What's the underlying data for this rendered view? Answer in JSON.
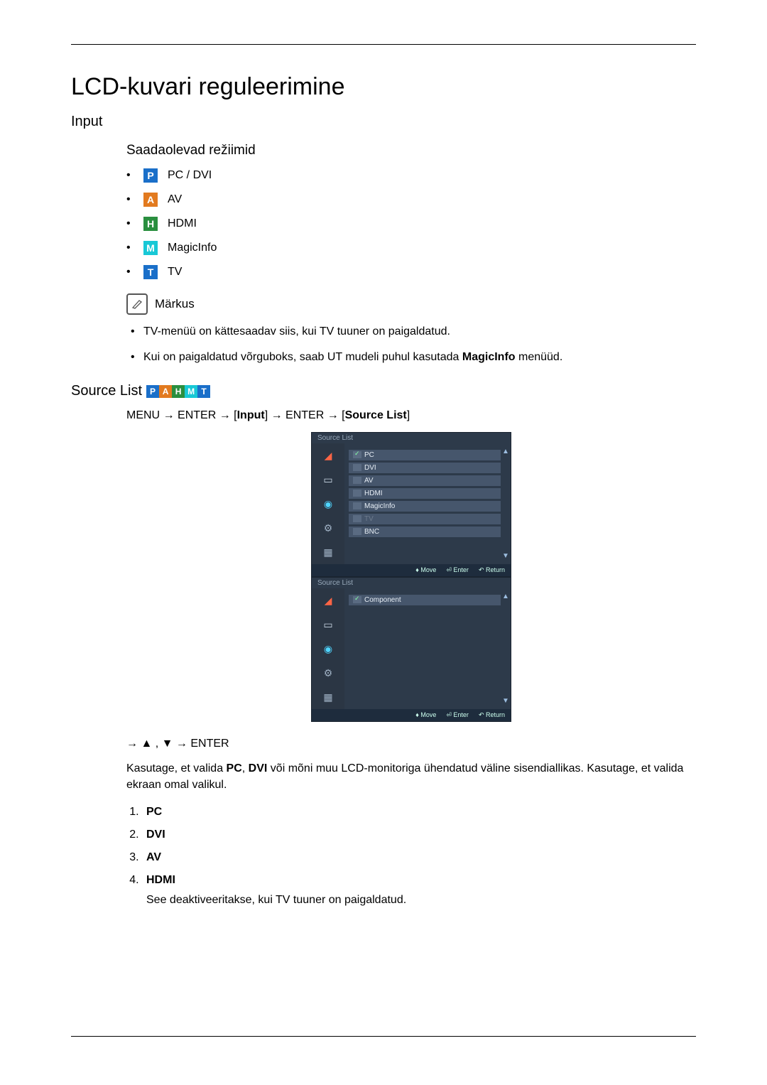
{
  "title": "LCD-kuvari reguleerimine",
  "input_section": "Input",
  "modes_heading": "Saadaolevad režiimid",
  "modes": {
    "pc_dvi": "PC / DVI",
    "av": "AV",
    "hdmi": "HDMI",
    "magicinfo": "MagicInfo",
    "tv": "TV"
  },
  "note_label": "Märkus",
  "notes": [
    "TV-menüü on kättesaadav siis, kui TV tuuner on paigaldatud.",
    "Kui on paigaldatud võrguboks, saab UT mudeli puhul kasutada MagicInfo menüüd."
  ],
  "source_list_label": "Source List",
  "menu_path": {
    "menu": "MENU",
    "arrow": "→",
    "enter": "ENTER",
    "input_br": "Input",
    "source_list_br": "Source List"
  },
  "osd": {
    "title": "Source List",
    "items1": [
      "PC",
      "DVI",
      "AV",
      "HDMI",
      "MagicInfo",
      "TV",
      "BNC"
    ],
    "items2": [
      "Component"
    ],
    "footer_move": "Move",
    "footer_enter": "Enter",
    "footer_return": "Return"
  },
  "after_nav": "→ ▲ , ▼ → ENTER",
  "desc_para": "Kasutage, et valida PC, DVI või mõni muu LCD-monitoriga ühendatud väline sisendiallikas. Kasutage, et valida ekraan omal valikul.",
  "desc_para_parts": {
    "p1a": "Kasutage, et valida ",
    "pc": "PC",
    "comma1": ", ",
    "dvi": "DVI",
    "p1b": " või mõni muu LCD-monitoriga ühendatud väline sisendiallikas. Kasutage, et valida ekraan omal valikul."
  },
  "numbered": {
    "n1": "PC",
    "n2": "DVI",
    "n3": "AV",
    "n4": "HDMI",
    "n4_desc": "See deaktiveeritakse, kui TV tuuner on paigaldatud."
  }
}
